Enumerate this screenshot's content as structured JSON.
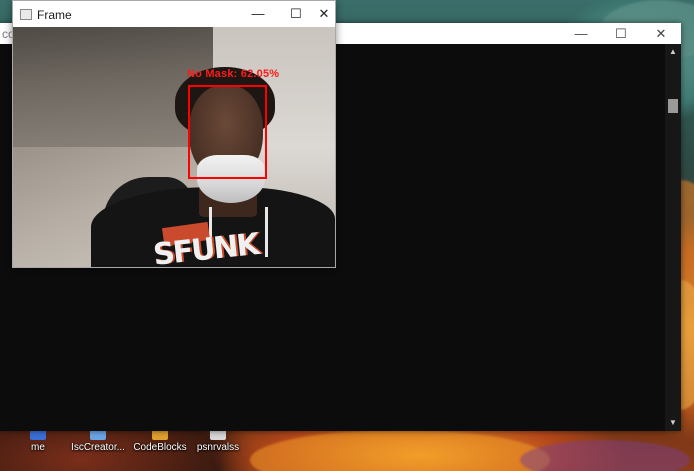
{
  "desktop": {
    "icons": [
      {
        "label": "me",
        "icon": "folder-icon",
        "color": "#3b6fd8"
      },
      {
        "label": "IscCreator...",
        "icon": "app-icon",
        "color": "#6aa5e8"
      },
      {
        "label": "CodeBlocks",
        "icon": "codeblocks-icon",
        "color": "#e0a030"
      },
      {
        "label": "psnrvalss",
        "icon": "file-icon",
        "color": "#d8d8d8"
      }
    ]
  },
  "console_window": {
    "title": "co",
    "controls": {
      "minimize": "—",
      "maximize": "☐",
      "close": "✕"
    }
  },
  "frame_window": {
    "title": "Frame",
    "controls": {
      "minimize": "—",
      "maximize": "☐",
      "close": "✕"
    },
    "detection": {
      "label": "No Mask: 62.05%",
      "box_color": "#ff0000"
    },
    "shirt_print": "SFUNK"
  },
  "colors": {
    "console_bg": "#0c0c0c",
    "detection": "#ff0000"
  }
}
